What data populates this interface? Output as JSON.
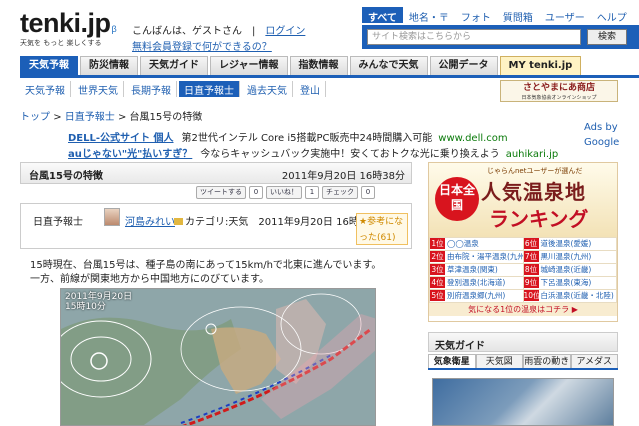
{
  "header": {
    "logo": "tenki.jp",
    "logo_beta": "β",
    "tagline": "天気を もっと 楽しくする",
    "greeting": "こんばんは、ゲストさん",
    "login": "ログイン",
    "signup_link": "無料会員登録で何ができるの？",
    "search_tabs": [
      "すべて",
      "地名・〒",
      "フォト",
      "質問箱",
      "ユーザー",
      "ヘルプ"
    ],
    "search_placeholder": "サイト検索はこちらから",
    "search_button": "検索"
  },
  "nav": {
    "tabs": [
      "天気予報",
      "防災情報",
      "天気ガイド",
      "レジャー情報",
      "指数情報",
      "みんなで天気",
      "公開データ",
      "MY tenki.jp"
    ],
    "subtabs": [
      "天気予報",
      "世界天気",
      "長期予報",
      "日直予報士",
      "過去天気",
      "登山"
    ]
  },
  "shop_ad": {
    "title": "さとやまにあ商店",
    "sub": "日本気象協会オンラインショップ"
  },
  "breadcrumb": {
    "home": "トップ",
    "sep": ">",
    "section": "日直予報士",
    "current": "台風15号の特徴"
  },
  "ads": {
    "label": "Ads by Google",
    "items": [
      {
        "title": "DELL-公式サイト 個人",
        "text": "第2世代インテル Core i5搭載PC販売中24時間購入可能",
        "url": "www.dell.com"
      },
      {
        "title": "auじゃない\"光\"払いすぎ？",
        "text": "今ならキャッシュバック実施中！安くておトクな光に乗り換えよう",
        "url": "auhikari.jp"
      }
    ]
  },
  "article": {
    "title": "台風15号の特徴",
    "date": "2011年9月20日 16時38分",
    "social": {
      "tweet": "ツイートする",
      "tweet_count": "0",
      "like": "いいね！",
      "like_count": "1",
      "check": "チェック",
      "check_count": "0"
    },
    "author_label": "日直予報士",
    "author": "河島みれい",
    "category": "カテゴリ:天気",
    "post_date": "2011年9月20日 16時38分",
    "helpful": "参考になった(61)",
    "body": [
      "15時現在、台風15号は、種子島の南にあって15km/hで北東に進んでいます。",
      "一方、前線が関東地方から中国地方にのびています。"
    ],
    "map_date": "2011年9月20日",
    "map_time": "15時10分"
  },
  "onsen": {
    "kicker": "じゃらんnetユーザーが選んだ",
    "title": "人気温泉地",
    "ranking": "ランキング",
    "badge": "日本全国",
    "items": [
      {
        "no": "1位",
        "name": "◯◯温泉"
      },
      {
        "no": "6位",
        "name": "道後温泉(愛媛)"
      },
      {
        "no": "2位",
        "name": "由布院・湯平温泉(九州)"
      },
      {
        "no": "7位",
        "name": "黒川温泉(九州)"
      },
      {
        "no": "3位",
        "name": "草津温泉(関東)"
      },
      {
        "no": "8位",
        "name": "城崎温泉(近畿)"
      },
      {
        "no": "4位",
        "name": "登別温泉(北海道)"
      },
      {
        "no": "9位",
        "name": "下呂温泉(東海)"
      },
      {
        "no": "5位",
        "name": "別府温泉郷(九州)"
      },
      {
        "no": "10位",
        "name": "白浜温泉(近畿・北陸)"
      }
    ],
    "footer": "気になる1位の温泉はコチラ ▶"
  },
  "guide": {
    "title": "天気ガイド",
    "tabs": [
      "気象衛星",
      "天気図",
      "雨雲の動き",
      "アメダス"
    ]
  }
}
